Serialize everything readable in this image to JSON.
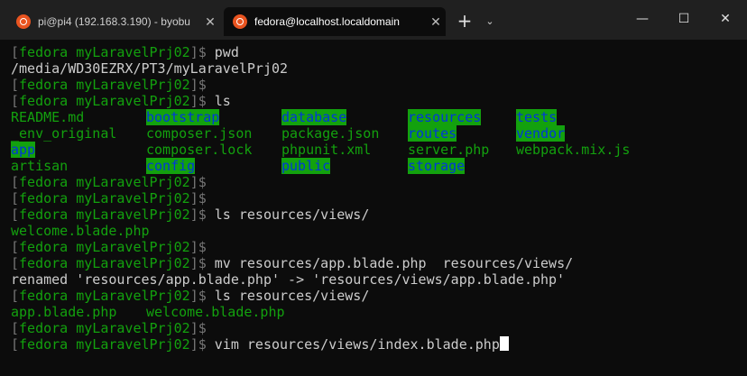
{
  "window": {
    "tabs": [
      {
        "title": "pi@pi4 (192.168.3.190) - byobu",
        "active": false
      },
      {
        "title": "fedora@localhost.localdomain",
        "active": true
      }
    ]
  },
  "prompt": {
    "open": "[",
    "user": "fedora",
    "space": " ",
    "dir": "myLaravelPrj02",
    "close": "]$"
  },
  "terminal": {
    "cmd_pwd": " pwd",
    "pwd_output": "/media/WD30EZRX/PT3/myLaravelPrj02",
    "cmd_ls": " ls",
    "ls_columns": [
      [
        "README.md",
        "_env_original",
        "app",
        "artisan"
      ],
      [
        "bootstrap",
        "composer.json",
        "composer.lock",
        "config"
      ],
      [
        "database",
        "package.json",
        "phpunit.xml",
        "public"
      ],
      [
        "resources",
        "routes",
        "server.php",
        "storage"
      ],
      [
        "tests",
        "vendor",
        "webpack.mix.js",
        ""
      ]
    ],
    "cmd_ls_views": " ls resources/views/",
    "ls_views_output_1": "welcome.blade.php",
    "cmd_mv": " mv resources/app.blade.php  resources/views/",
    "mv_output": "renamed 'resources/app.blade.php' -> 'resources/views/app.blade.php'",
    "ls_views_output_2a": "app.blade.php",
    "ls_views_output_2b": "welcome.blade.php",
    "cmd_vim": " vim resources/views/index.blade.php"
  },
  "colors": {
    "background": "#0c0c0c",
    "prompt_bracket": "#767676",
    "prompt_green": "#13a10e",
    "dir_bg": "#13a10e",
    "dir_fg": "#0037da",
    "text": "#cccccc"
  },
  "icons": [
    "ubuntu-icon",
    "close-icon",
    "plus-icon",
    "chevron-down-icon",
    "minimize-icon",
    "maximize-icon",
    "close-window-icon"
  ]
}
